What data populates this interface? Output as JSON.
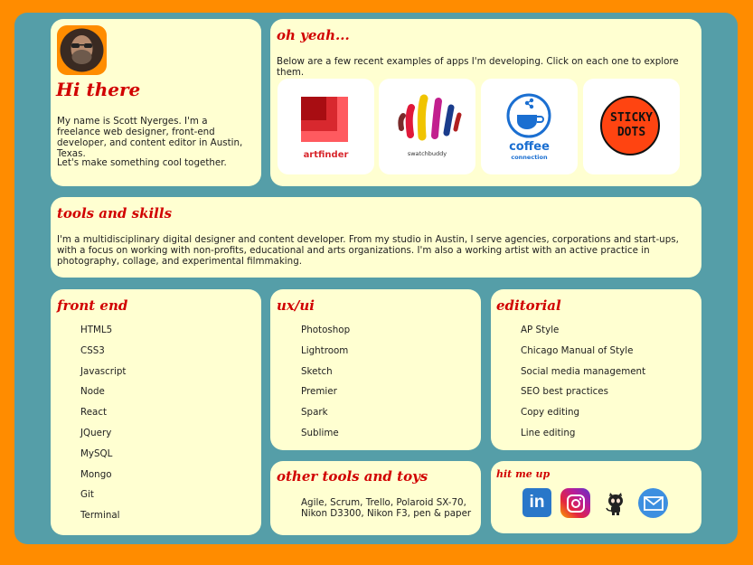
{
  "intro": {
    "title": "Hi there",
    "bio": "My name is Scott Nyerges. I'm a freelance web designer, front-end developer, and content editor in Austin, Texas.",
    "cta": "Let's make something cool together."
  },
  "apps": {
    "title": "oh yeah...",
    "subtitle": "Below are a few recent examples of apps I'm developing. Click on each one to explore them.",
    "items": [
      {
        "name": "artfinder",
        "icon": "artfinder-logo-icon"
      },
      {
        "name": "swatchbuddy",
        "icon": "swatchbuddy-logo-icon"
      },
      {
        "name": "coffee",
        "sub": "connection",
        "icon": "coffee-cup-icon"
      },
      {
        "name": "STICKY",
        "sub": "DOTS",
        "icon": "sticky-dots-logo-icon"
      }
    ]
  },
  "tools": {
    "title": "tools and skills",
    "text": "I'm a multidisciplinary digital designer and content developer. From my studio in Austin, I serve agencies, corporations and start-ups, with a focus on working with non-profits, educational and arts organizations. I'm also a working artist with an active practice in photography, collage, and experimental filmmaking."
  },
  "frontend": {
    "title": "front end",
    "items": [
      "HTML5",
      "CSS3",
      "Javascript",
      "Node",
      "React",
      "JQuery",
      "MySQL",
      "Mongo",
      "Git",
      "Terminal"
    ]
  },
  "uxui": {
    "title": "ux/ui",
    "items": [
      "Photoshop",
      "Lightroom",
      "Sketch",
      "Premier",
      "Spark",
      "Sublime"
    ]
  },
  "editorial": {
    "title": "editorial",
    "items": [
      "AP Style",
      "Chicago Manual of Style",
      "Social media management",
      "SEO best practices",
      "Copy editing",
      "Line editing"
    ]
  },
  "other": {
    "title": "other tools and toys",
    "line1": "Agile, Scrum, Trello, Polaroid SX-70,",
    "line2": "Nikon D3300, Nikon F3, pen & paper"
  },
  "contact": {
    "title": "hit me up",
    "links": [
      {
        "name": "LinkedIn",
        "icon": "linkedin-icon",
        "glyph": "in"
      },
      {
        "name": "Instagram",
        "icon": "instagram-icon"
      },
      {
        "name": "GitHub",
        "icon": "github-icon"
      },
      {
        "name": "Email",
        "icon": "email-icon"
      }
    ]
  },
  "colors": {
    "page_bg": "#ff8c00",
    "frame_bg": "#559ea8",
    "card_bg": "#ffffd1",
    "heading": "#d10000"
  }
}
